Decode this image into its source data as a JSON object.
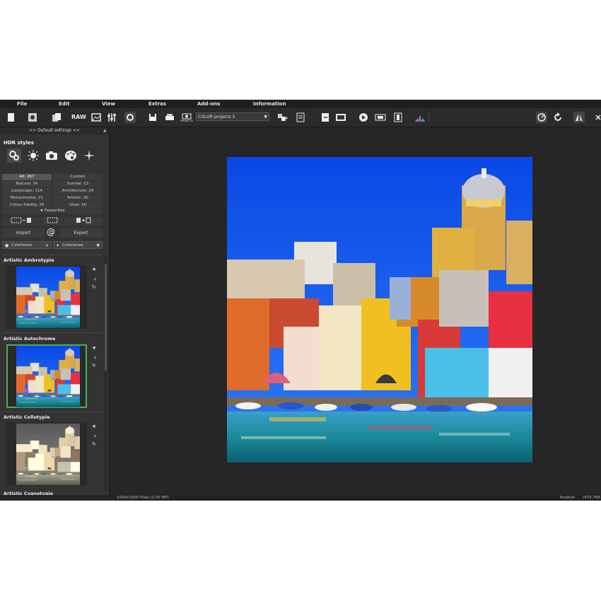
{
  "menu": [
    "File",
    "Edit",
    "View",
    "Extras",
    "Add-ons",
    "Information"
  ],
  "toolbar": {
    "raw_label": "RAW",
    "projects_label": "PROJECTS",
    "project_select": "COLOR projects 5"
  },
  "panel": {
    "default_settings": ">> Default settings <<",
    "hdr_styles_title": "HDR styles",
    "categories": [
      {
        "left": "All: 267",
        "right": "Custom"
      },
      {
        "left": "Natural: 34",
        "right": "Surreal: 13"
      },
      {
        "left": "Landscape: 114",
        "right": "Architecture: 19"
      },
      {
        "left": "Monochrome: 21",
        "right": "Artistic: 30"
      },
      {
        "left": "Colour fidelity: 20",
        "right": "Glow: 16"
      }
    ],
    "favourites": "Favourites",
    "import_label": "Import",
    "export_label": "Export",
    "at_symbol": "@",
    "filter_left": "Colortones",
    "filter_right": "Colortones",
    "presets": [
      {
        "name": "Artistic Ambrotypie",
        "selected": false,
        "tone": "color"
      },
      {
        "name": "Artistic Autochrome",
        "selected": true,
        "tone": "color"
      },
      {
        "name": "Artistic Collotypie",
        "selected": false,
        "tone": "sepia"
      }
    ],
    "next_preset_partial": "Artistic Cyanotypie"
  },
  "status": {
    "image_info": "1000x1000 Pixel (1.00 MP)",
    "position_label": "Position",
    "position_value": "(475,766"
  },
  "colors": {
    "selection_border": "#4caf50",
    "app_background": "#262626",
    "panel_background": "#333333"
  }
}
